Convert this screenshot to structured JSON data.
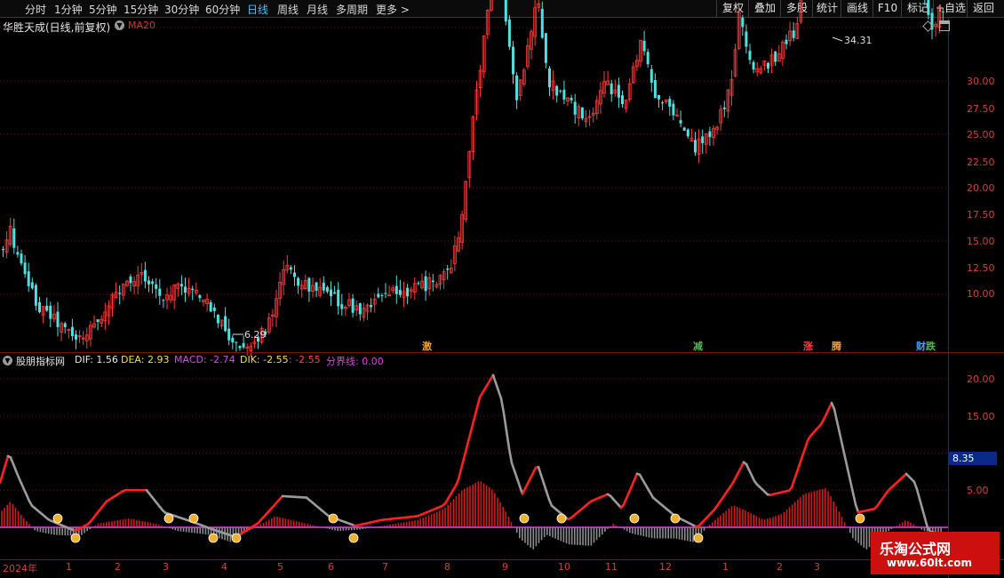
{
  "toolbar": {
    "periods": [
      "分时",
      "1分钟",
      "5分钟",
      "15分钟",
      "30分钟",
      "60分钟",
      "日线",
      "周线",
      "月线",
      "多周期",
      "更多"
    ],
    "active_period": "日线",
    "right_buttons": [
      "复权",
      "叠加",
      "多股",
      "统计",
      "画线",
      "F10",
      "标记",
      "+自选",
      "返回"
    ]
  },
  "stock": {
    "title": "华胜天成(日线,前复权)",
    "ma_label": "MA20",
    "high_label": "34.31",
    "low_label": "6.29"
  },
  "price_axis": [
    "30.00",
    "27.50",
    "25.00",
    "22.50",
    "20.00",
    "17.50",
    "15.00",
    "12.50",
    "10.00"
  ],
  "events": [
    {
      "label": "激",
      "color": "#f0a030"
    },
    {
      "label": "减",
      "color": "#40c040"
    },
    {
      "label": "涨",
      "color": "#ff4040"
    },
    {
      "label": "腾",
      "color": "#f0a030"
    },
    {
      "label": "财",
      "color": "#40a0ff"
    },
    {
      "label": "跌",
      "color": "#40c040"
    }
  ],
  "indicator": {
    "name": "股朋指标网",
    "dif": "DIF: 1.56",
    "dea": "DEA: 2.93",
    "macd": "MACD: -2.74",
    "dik": "DIK: -2.55",
    "dik2": ": -2.55",
    "boundary": "分界线: 0.00",
    "axis": [
      "20.00",
      "15.00",
      "10.00",
      "5.00"
    ],
    "highlight": "8.35"
  },
  "x_axis": [
    "2024年",
    "1",
    "2",
    "3",
    "4",
    "5",
    "6",
    "7",
    "8",
    "9",
    "10",
    "11",
    "12",
    "1",
    "2",
    "3"
  ],
  "watermark": {
    "line1": "乐淘公式网",
    "line2": "www.60lt.com"
  },
  "colors": {
    "up": "#ff3a3a",
    "down": "#4fe0e0",
    "grid": "#7a1010",
    "axis_text": "#d04040",
    "dif_up": "#ff2020",
    "dif_down": "#9a9a9a",
    "macd_pos": "#d81818",
    "macd_neg": "#8c8c8c",
    "signal": "#f0b030",
    "boundary": "#e040e0"
  },
  "chart_data": {
    "type": "candlestick-with-indicator",
    "title": "华胜天成(日线,前复权)",
    "price_axis_ticks": [
      10,
      12.5,
      15,
      17.5,
      20,
      22.5,
      25,
      27.5,
      30
    ],
    "price_high": 34.31,
    "price_low": 6.29,
    "closes_approx": [
      {
        "x": "2024-01",
        "y": 11.0
      },
      {
        "x": "2024-02",
        "y": 8.0
      },
      {
        "x": "2024-03",
        "y": 10.5
      },
      {
        "x": "2024-04",
        "y": 7.5
      },
      {
        "x": "2024-05",
        "y": 10.5
      },
      {
        "x": "2024-06",
        "y": 9.0
      },
      {
        "x": "2024-07",
        "y": 9.5
      },
      {
        "x": "2024-08",
        "y": 12.0
      },
      {
        "x": "2024-09",
        "y": 25.0
      },
      {
        "x": "2024-10",
        "y": 19.5
      },
      {
        "x": "2024-11",
        "y": 19.0
      },
      {
        "x": "2024-12",
        "y": 17.0
      },
      {
        "x": "2025-01",
        "y": 21.0
      },
      {
        "x": "2025-02",
        "y": 29.0
      },
      {
        "x": "2025-03",
        "y": 25.0
      }
    ],
    "indicator_axis_ticks": [
      5,
      10,
      15,
      20
    ],
    "indicator_values": {
      "DIF": 1.56,
      "DEA": 2.93,
      "MACD": -2.74,
      "DIK": -2.55,
      "分界线": 0.0
    }
  }
}
